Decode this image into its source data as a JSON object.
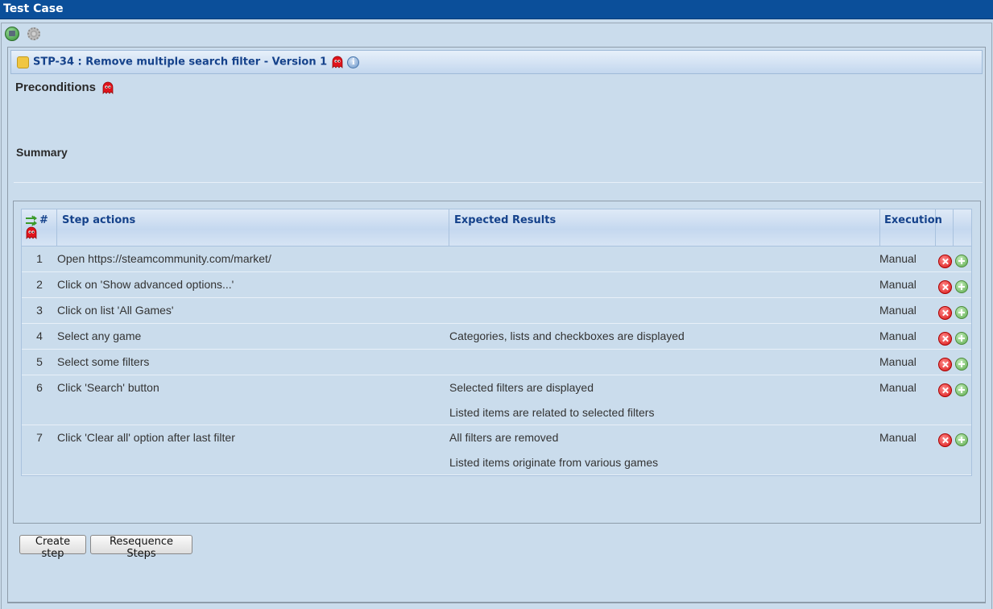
{
  "window": {
    "title": "Test Case"
  },
  "testcase": {
    "title": "STP-34 : Remove multiple search filter - Version 1"
  },
  "sections": {
    "preconditions": "Preconditions",
    "summary": "Summary"
  },
  "grid": {
    "columns": {
      "num": "#",
      "actions": "Step actions",
      "expected": "Expected Results",
      "execution": "Execution"
    },
    "rows": [
      {
        "num": "1",
        "action": "Open https://steamcommunity.com/market/",
        "expected": [],
        "execution": "Manual"
      },
      {
        "num": "2",
        "action": "Click on 'Show advanced options...'",
        "expected": [],
        "execution": "Manual"
      },
      {
        "num": "3",
        "action": "Click on list 'All Games'",
        "expected": [],
        "execution": "Manual"
      },
      {
        "num": "4",
        "action": "Select any game",
        "expected": [
          "Categories, lists and checkboxes are displayed"
        ],
        "execution": "Manual"
      },
      {
        "num": "5",
        "action": "Select some filters",
        "expected": [],
        "execution": "Manual"
      },
      {
        "num": "6",
        "action": "Click 'Search' button",
        "expected": [
          "Selected filters are displayed",
          "Listed items are related to selected filters"
        ],
        "execution": "Manual"
      },
      {
        "num": "7",
        "action": "Click 'Clear all' option after last filter",
        "expected": [
          "All filters are removed",
          "Listed items originate from various games"
        ],
        "execution": "Manual"
      }
    ]
  },
  "buttons": {
    "create_step": "Create step",
    "resequence": "Resequence Steps"
  },
  "icons": {
    "back": "back-arrow-icon",
    "settings": "gear-icon",
    "testcase": "puzzle-icon",
    "ghost": "ghost-icon",
    "info": "info-icon",
    "reorder": "reorder-arrows-icon",
    "delete": "delete-icon",
    "add": "add-icon"
  },
  "colors": {
    "titlebar": "#0b4f9a",
    "header_text": "#15428b",
    "background": "#cadcec"
  }
}
